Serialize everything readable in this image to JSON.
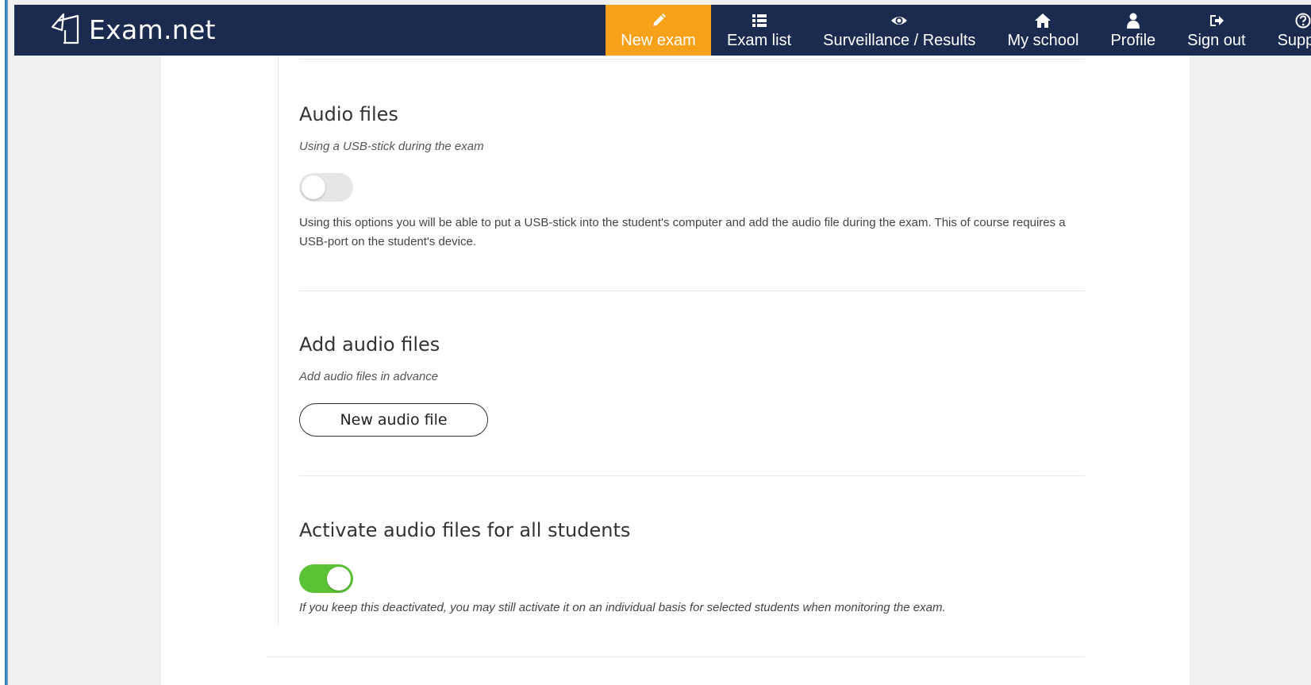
{
  "app": {
    "logo_text": "Exam.net"
  },
  "nav": {
    "items": [
      {
        "label": "New exam",
        "icon": "pencil-icon",
        "active": true
      },
      {
        "label": "Exam list",
        "icon": "list-icon",
        "active": false
      },
      {
        "label": "Surveillance / Results",
        "icon": "eye-icon",
        "active": false
      },
      {
        "label": "My school",
        "icon": "home-icon",
        "active": false
      },
      {
        "label": "Profile",
        "icon": "user-icon",
        "active": false
      },
      {
        "label": "Sign out",
        "icon": "sign-out-icon",
        "active": false
      },
      {
        "label": "Suppor",
        "icon": "question-icon",
        "active": false
      }
    ]
  },
  "sections": {
    "audio_files": {
      "title": "Audio files",
      "subtitle": "Using a USB-stick during the exam",
      "toggle_on": false,
      "description": "Using this options you will be able to put a USB-stick into the student's computer and add the audio file during the exam. This of course requires a USB-port on the student's device."
    },
    "add_audio": {
      "title": "Add audio files",
      "subtitle": "Add audio files in advance",
      "button_label": "New audio file"
    },
    "activate": {
      "title": "Activate audio files for all students",
      "toggle_on": true,
      "note": "If you keep this deactivated, you may still activate it on an individual basis for selected students when monitoring the exam."
    }
  },
  "colors": {
    "topbar": "#1b2b4f",
    "active_tab": "#f7a11a",
    "toggle_on": "#5bc236",
    "toggle_off": "#e6e6e6"
  }
}
